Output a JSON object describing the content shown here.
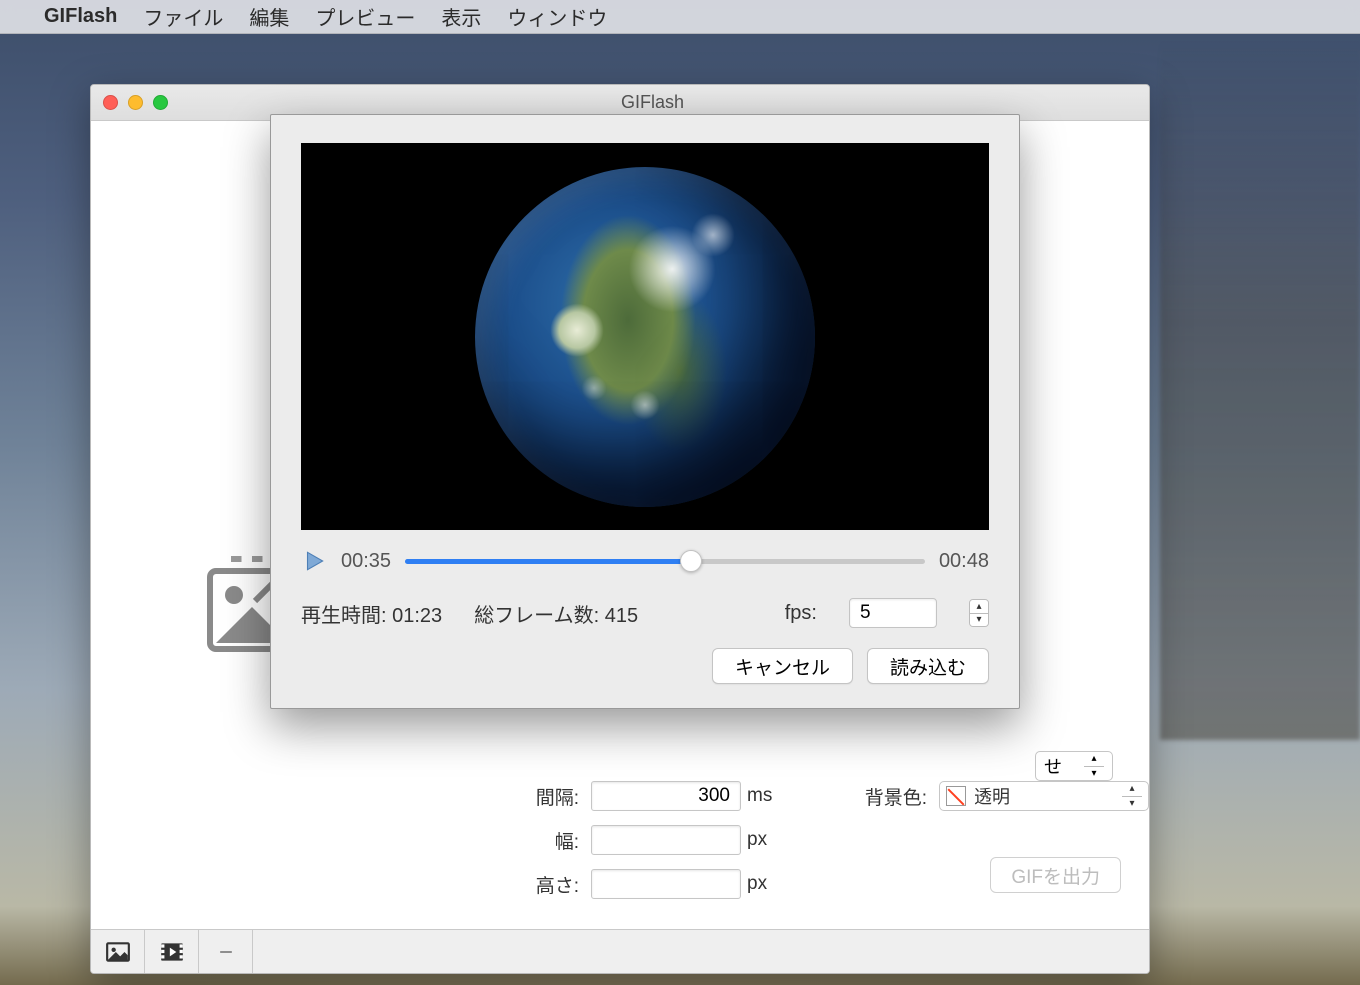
{
  "menubar": {
    "app_name": "GIFlash",
    "items": [
      "ファイル",
      "編集",
      "プレビュー",
      "表示",
      "ウィンドウ"
    ]
  },
  "window": {
    "title": "GIFlash"
  },
  "modal": {
    "playback": {
      "current_time": "00:35",
      "end_time": "00:48",
      "progress_percent": 55
    },
    "duration_label": "再生時間:",
    "duration_value": "01:23",
    "frames_label": "総フレーム数:",
    "frames_value": "415",
    "fps_label": "fps:",
    "fps_value": "5",
    "cancel_label": "キャンセル",
    "load_label": "読み込む"
  },
  "settings": {
    "interval_label": "間隔:",
    "interval_value": "300",
    "interval_unit": "ms",
    "bgcolor_label": "背景色:",
    "bgcolor_value": "透明",
    "width_label": "幅:",
    "width_value": "",
    "width_unit": "px",
    "height_label": "高さ:",
    "height_value": "",
    "height_unit": "px",
    "hidden_select_suffix": "せ",
    "export_label": "GIFを出力"
  }
}
